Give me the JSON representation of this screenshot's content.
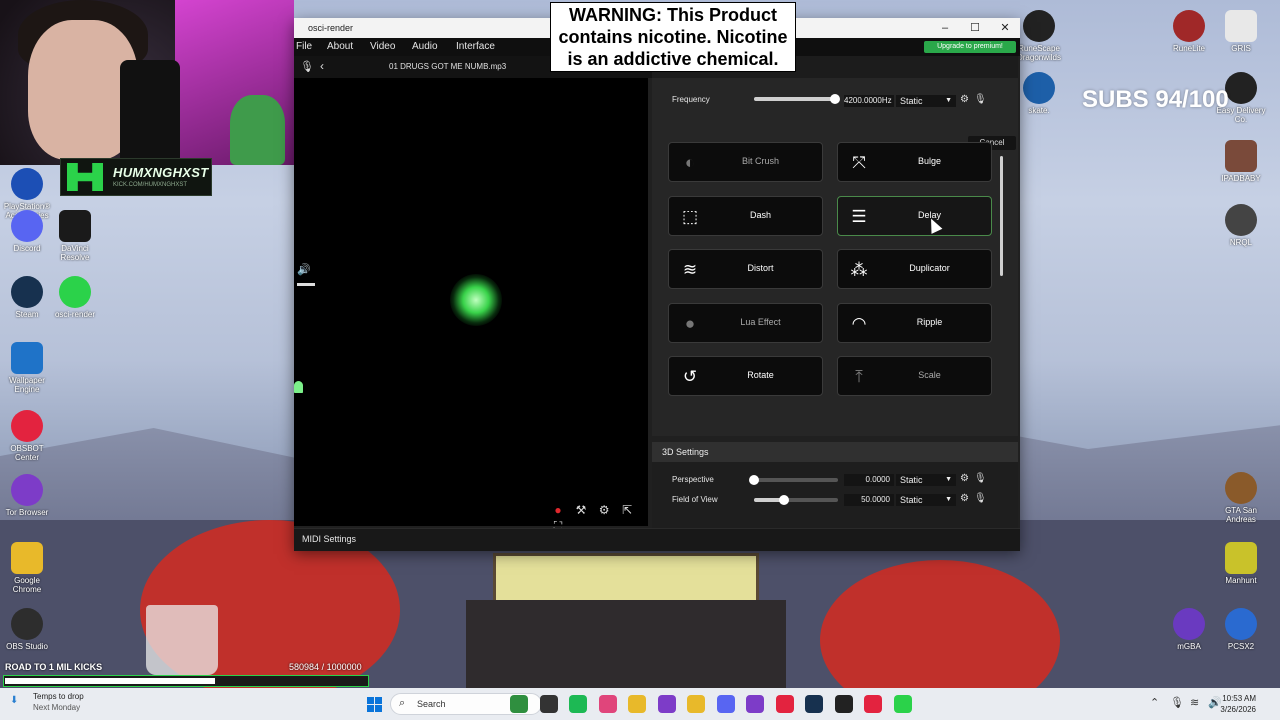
{
  "overlay": {
    "warning_lines": [
      "WARNING: This Product",
      "contains nicotine. Nicotine",
      "is an addictive chemical."
    ],
    "subs_goal": "SUBS 94/100",
    "channel_name": "HUMXNGHXST",
    "channel_url": "KICK.COM/HUMXNGHXST",
    "road_label": "ROAD TO 1 MIL KICKS",
    "kicks_count": "580984",
    "kicks_goal": "/ 1000000",
    "kicks_progress": 0.580984
  },
  "desktop": {
    "left_icons": [
      {
        "label": "PlayStation® Accessories",
        "icon": "playstation-icon",
        "color": "#1c4fb5"
      },
      {
        "label": "Discord",
        "icon": "discord-icon",
        "color": "#5865f2"
      },
      {
        "label": "DaVinci Resolve",
        "icon": "davinci-icon",
        "color": "#1a1a1a"
      },
      {
        "label": "Steam",
        "icon": "steam-icon",
        "color": "#17314f"
      },
      {
        "label": "osci-render",
        "icon": "osci-render-icon",
        "color": "#2bd24a"
      },
      {
        "label": "Wallpaper Engine",
        "icon": "wallpaper-engine-icon",
        "color": "#1f73c8"
      },
      {
        "label": "OBSBOT Center",
        "icon": "obsbot-icon",
        "color": "#e3233f"
      },
      {
        "label": "Tor Browser",
        "icon": "tor-icon",
        "color": "#7d3cc8"
      },
      {
        "label": "Google Chrome",
        "icon": "chrome-icon",
        "color": "#e8b92a"
      },
      {
        "label": "OBS Studio",
        "icon": "obs-icon",
        "color": "#2d2d2d"
      }
    ],
    "right_icons": [
      {
        "label": "RuneScape Dragonwilds",
        "icon": "runescape-icon",
        "color": "#222"
      },
      {
        "label": "RuneLite",
        "icon": "runelite-icon",
        "color": "#a02828"
      },
      {
        "label": "GRIS",
        "icon": "gris-icon",
        "color": "#e8e8e8"
      },
      {
        "label": "skate.",
        "icon": "skate-icon",
        "color": "#1d5fa8"
      },
      {
        "label": "Easy Delivery Co.",
        "icon": "easy-delivery-icon",
        "color": "#222"
      },
      {
        "label": "IPADBABY",
        "icon": "ipadbaby-icon",
        "color": "#7a4a3a"
      },
      {
        "label": "NRQL",
        "icon": "nrql-icon",
        "color": "#444"
      },
      {
        "label": "GTA San Andreas",
        "icon": "gta-icon",
        "color": "#8a5a2a"
      },
      {
        "label": "Manhunt",
        "icon": "manhunt-icon",
        "color": "#c9c22a"
      },
      {
        "label": "mGBA",
        "icon": "mgba-icon",
        "color": "#6a3ac0"
      },
      {
        "label": "PCSX2",
        "icon": "pcsx2-icon",
        "color": "#2a6ad0"
      }
    ]
  },
  "window": {
    "title": "osci-render",
    "controls": {
      "minimize": "–",
      "maximize": "☐",
      "close": "✕"
    },
    "menu": [
      "File",
      "About",
      "Video",
      "Audio",
      "Interface"
    ],
    "premium_label": "Upgrade to premium!",
    "track_name": "01 DRUGS GOT ME NUMB.mp3",
    "midi_label": "MIDI Settings"
  },
  "effects_panel": {
    "frequency": {
      "label": "Frequency",
      "value": "4200.0000Hz",
      "mode": "Static",
      "slider_fraction": 0.97
    },
    "cancel_label": "Cancel",
    "effects": [
      {
        "label": "Bit Crush",
        "icon": "bit-crush-icon",
        "glyph": "◐",
        "dim": true
      },
      {
        "label": "Bulge",
        "icon": "bulge-icon",
        "glyph": "⤧",
        "dim": false
      },
      {
        "label": "Dash",
        "icon": "dash-icon",
        "glyph": "⬚",
        "dim": false
      },
      {
        "label": "Delay",
        "icon": "delay-icon",
        "glyph": "☰",
        "dim": false,
        "hover": true
      },
      {
        "label": "Distort",
        "icon": "distort-icon",
        "glyph": "≋",
        "dim": false
      },
      {
        "label": "Duplicator",
        "icon": "duplicator-icon",
        "glyph": "⁂",
        "dim": false
      },
      {
        "label": "Lua Effect",
        "icon": "lua-icon",
        "glyph": "●",
        "dim": true
      },
      {
        "label": "Ripple",
        "icon": "ripple-icon",
        "glyph": "◠",
        "dim": false
      },
      {
        "label": "Rotate",
        "icon": "rotate-icon",
        "glyph": "↺",
        "dim": false
      },
      {
        "label": "Scale",
        "icon": "scale-icon",
        "glyph": "⤒",
        "dim": true
      }
    ]
  },
  "settings_3d": {
    "title": "3D Settings",
    "rows": [
      {
        "label": "Perspective",
        "value": "0.0000",
        "mode": "Static",
        "slider_fraction": 0.0
      },
      {
        "label": "Field of View",
        "value": "50.0000",
        "mode": "Static",
        "slider_fraction": 0.36
      }
    ]
  },
  "taskbar": {
    "weather_title": "Temps to drop",
    "weather_sub": "Next Monday",
    "search_placeholder": "Search",
    "apps": [
      {
        "icon": "widgets-icon",
        "color": "#2f8f3f"
      },
      {
        "icon": "task-view-icon",
        "color": "#333"
      },
      {
        "icon": "spotify-icon",
        "color": "#1db954"
      },
      {
        "icon": "itunes-icon",
        "color": "#e0457b"
      },
      {
        "icon": "chrome-icon",
        "color": "#e8b92a"
      },
      {
        "icon": "tor-icon",
        "color": "#7d3cc8"
      },
      {
        "icon": "file-explorer-icon",
        "color": "#e8b92a"
      },
      {
        "icon": "discord-icon",
        "color": "#5865f2"
      },
      {
        "icon": "obsbot-icon",
        "color": "#7d3cc8"
      },
      {
        "icon": "obs-record-icon",
        "color": "#e3233f"
      },
      {
        "icon": "steam-icon",
        "color": "#17314f"
      },
      {
        "icon": "terminal-icon",
        "color": "#222"
      },
      {
        "icon": "chrome-alt-icon",
        "color": "#e3233f"
      },
      {
        "icon": "osci-render-icon",
        "color": "#2bd24a"
      }
    ],
    "time": "10:53 AM",
    "date": "3/26/2026"
  }
}
